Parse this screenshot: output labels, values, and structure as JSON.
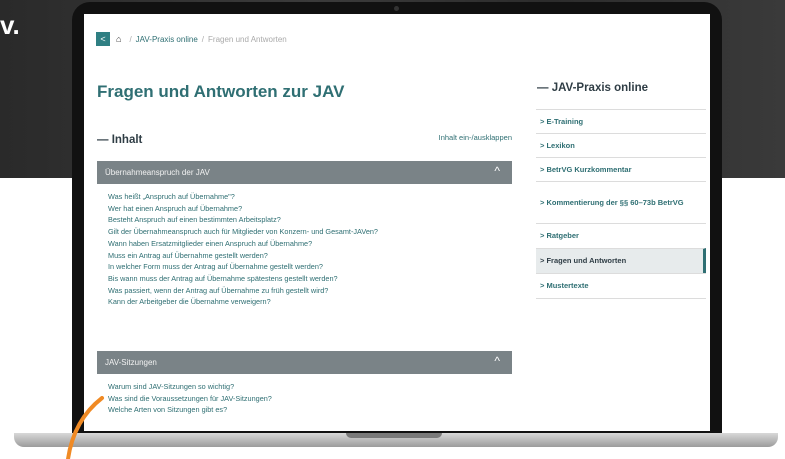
{
  "corner_text": "v.",
  "breadcrumb": {
    "back_icon": "<",
    "home_icon": "home-icon",
    "items": [
      "JAV-Praxis online",
      "Fragen und Antworten"
    ],
    "separator": "/"
  },
  "page_title": "Fragen und Antworten zur JAV",
  "toc": {
    "title": "— Inhalt",
    "toggle_label": "Inhalt ein-/ausklappen"
  },
  "sections": [
    {
      "title": "Übernahmeanspruch der JAV",
      "chevron": "^",
      "questions": [
        "Was heißt „Anspruch auf Übernahme\"?",
        "Wer hat einen Anspruch auf Übernahme?",
        "Besteht Anspruch auf einen bestimmten Arbeitsplatz?",
        "Gilt der Übernahmeanspruch auch für Mitglieder von Konzern- und Gesamt-JAVen?",
        "Wann haben Ersatzmitglieder einen Anspruch auf Übernahme?",
        "Muss ein Antrag auf Übernahme gestellt werden?",
        "In welcher Form muss der Antrag auf Übernahme gestellt werden?",
        "Bis wann muss der Antrag auf Übernahme spätestens gestellt werden?",
        "Was passiert, wenn der Antrag auf Übernahme zu früh gestellt wird?",
        "Kann der Arbeitgeber die Übernahme verweigern?"
      ]
    },
    {
      "title": "JAV-Sitzungen",
      "chevron": "^",
      "questions": [
        "Warum sind JAV-Sitzungen so wichtig?",
        "Was sind die Voraussetzungen für JAV-Sitzungen?",
        "Welche Arten von Sitzungen gibt es?"
      ]
    }
  ],
  "sidebar": {
    "title": "— JAV-Praxis online",
    "items": [
      {
        "label": "> E-Training",
        "active": false
      },
      {
        "label": "> Lexikon",
        "active": false
      },
      {
        "label": "> BetrVG Kurzkommentar",
        "active": false
      },
      {
        "label": "> Kommentierung der §§ 60–73b BetrVG",
        "active": false
      },
      {
        "label": "> Ratgeber",
        "active": false
      },
      {
        "label": "> Fragen und Antworten",
        "active": true
      },
      {
        "label": "> Mustertexte",
        "active": false
      }
    ]
  },
  "colors": {
    "accent": "#2f6f73",
    "section_bar": "#7a8387",
    "active_bg": "#e7ebec",
    "orange": "#f08a24"
  }
}
